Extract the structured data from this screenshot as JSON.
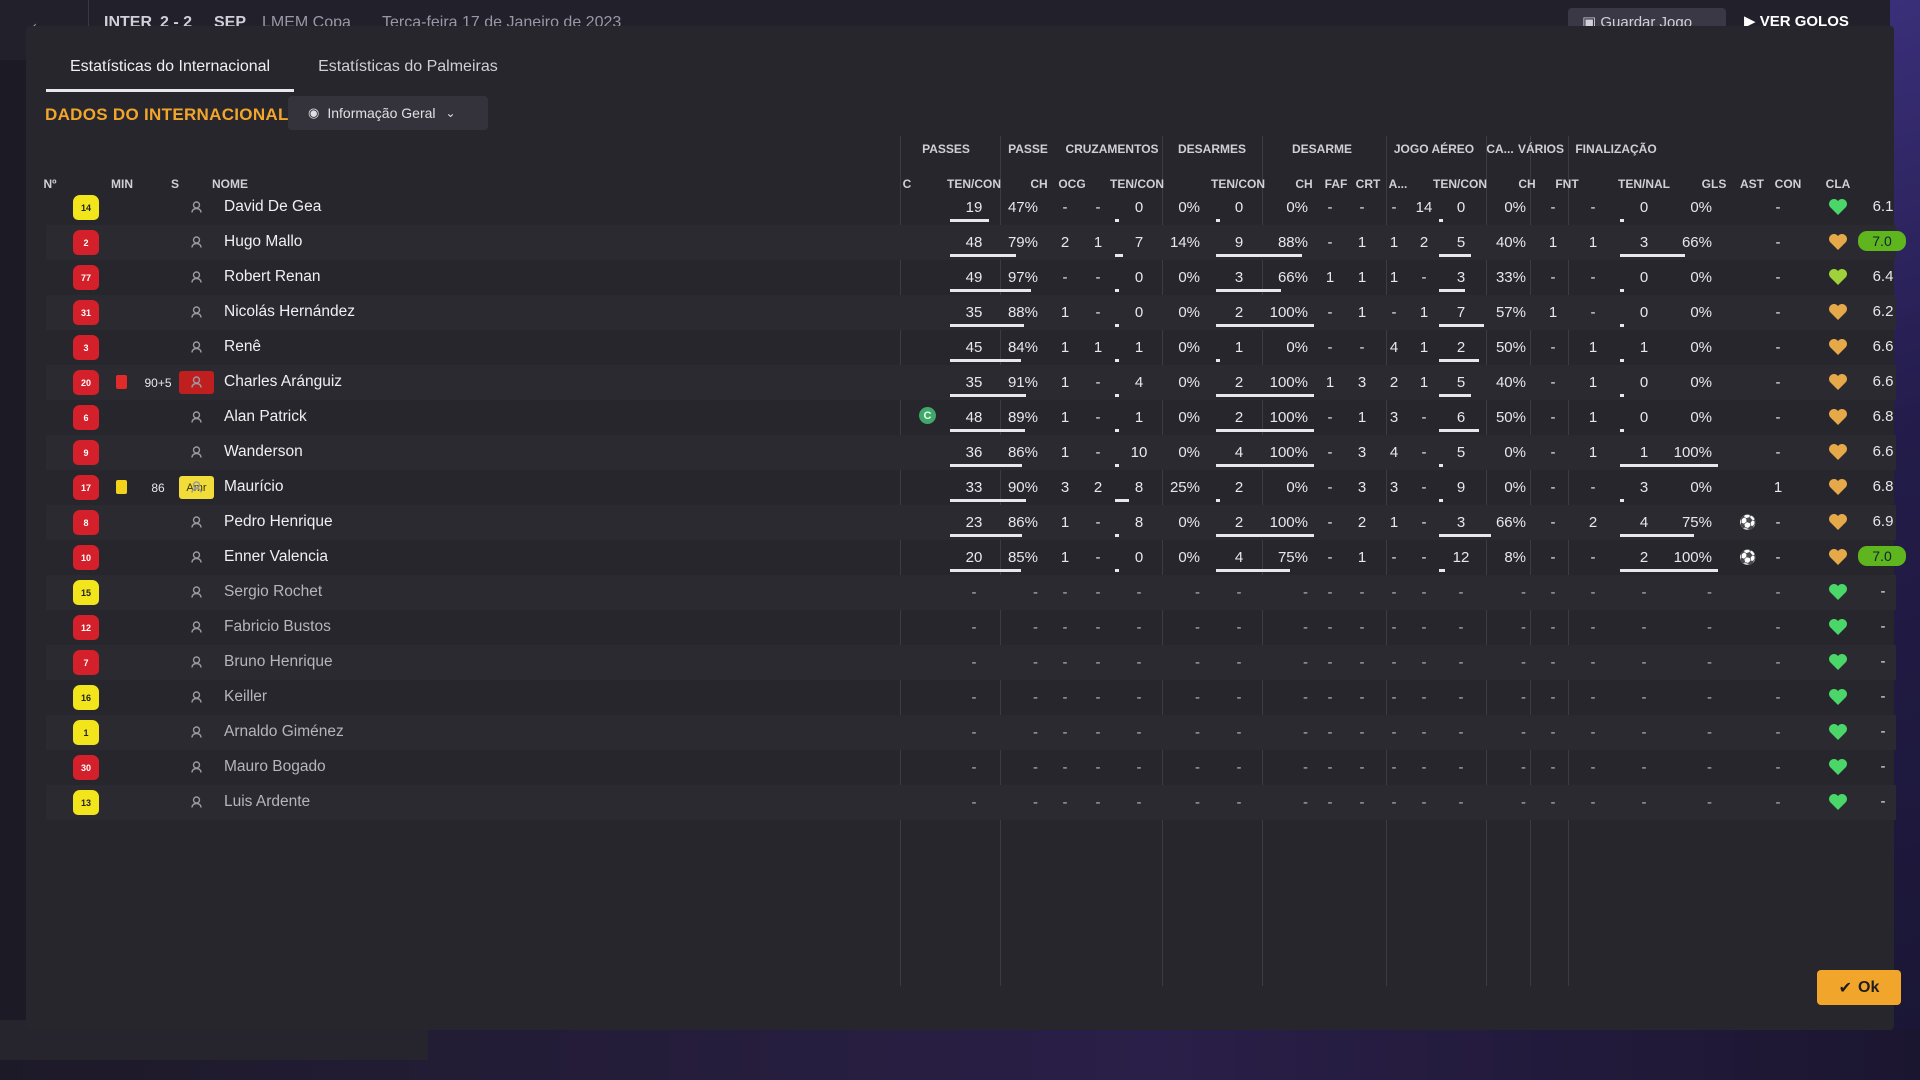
{
  "background": {
    "match_home": "INTER",
    "score": "2 - 2",
    "match_away": "SEP",
    "competition": "LMEM Copa",
    "date": "Terça-feira 17 de Janeiro de 2023",
    "save_label": "Guardar Jogo",
    "play_label": "VER GOLOS"
  },
  "tabs": [
    "Estatísticas do Internacional",
    "Estatísticas do Palmeiras"
  ],
  "section_title": "DADOS DO INTERNACIONAL",
  "view_dropdown": "Informação Geral",
  "group_headers": [
    "PASSES",
    "PASSE",
    "CRUZAMENTOS",
    "DESARMES",
    "DESARME",
    "JOGO AÉREO",
    "CA...",
    "VÁRIOS",
    "FINALIZAÇÃO"
  ],
  "columns": {
    "num": "Nº",
    "min": "MIN",
    "s": "S",
    "name": "NOME",
    "c": "C",
    "passes": "TEN/CON",
    "ch": "CH",
    "ocg": "OCG",
    "cross": "TEN/CON",
    "tackles": "TEN/CON",
    "d_ch": "CH",
    "d_faf": "FAF",
    "d_crt": "CRT",
    "d_a": "A...",
    "aerial": "TEN/CON",
    "ca_ch": "CH",
    "fnt": "FNT",
    "shots": "TEN/NAL",
    "gls": "GLS",
    "ast": "AST",
    "con": "CON",
    "cla": "CLA"
  },
  "colors": {
    "accent": "#f2a52b",
    "home_shirt": "#d4202a",
    "gk_shirt": "#f2e51b",
    "heart_green": "#4bd66a",
    "heart_gold": "#e6b84a"
  },
  "players": [
    {
      "num": "14",
      "shirt": "yellow",
      "name": "David De Gea",
      "pt": "19",
      "pp": "47%",
      "pch": "-",
      "ocg": "-",
      "ct": "0",
      "cp": "0%",
      "dt": "0",
      "dp": "0%",
      "dch": "-",
      "faf": "-",
      "crt": "-",
      "da": "14",
      "at": "0",
      "ap": "0%",
      "cach": "-",
      "fnt": "-",
      "st": "0",
      "sp": "0%",
      "gls": "",
      "ast": "-",
      "con": "green",
      "cla": "6.1"
    },
    {
      "num": "2",
      "shirt": "red",
      "name": "Hugo Mallo",
      "pt": "48",
      "pp": "79%",
      "pch": "2",
      "ocg": "1",
      "ct": "7",
      "cp": "14%",
      "dt": "9",
      "dp": "88%",
      "dch": "-",
      "faf": "1",
      "crt": "1",
      "da": "2",
      "at": "5",
      "ap": "40%",
      "cach": "1",
      "fnt": "1",
      "st": "3",
      "sp": "66%",
      "gls": "",
      "ast": "-",
      "con": "gold",
      "cla": "7.0",
      "hi": true
    },
    {
      "num": "77",
      "shirt": "red",
      "name": "Robert Renan",
      "pt": "49",
      "pp": "97%",
      "pch": "-",
      "ocg": "-",
      "ct": "0",
      "cp": "0%",
      "dt": "3",
      "dp": "66%",
      "dch": "1",
      "faf": "1",
      "crt": "1",
      "da": "-",
      "at": "3",
      "ap": "33%",
      "cach": "-",
      "fnt": "-",
      "st": "0",
      "sp": "0%",
      "gls": "",
      "ast": "-",
      "con": "lime",
      "cla": "6.4"
    },
    {
      "num": "31",
      "shirt": "red",
      "name": "Nicolás Hernández",
      "pt": "35",
      "pp": "88%",
      "pch": "1",
      "ocg": "-",
      "ct": "0",
      "cp": "0%",
      "dt": "2",
      "dp": "100%",
      "dch": "-",
      "faf": "1",
      "crt": "-",
      "da": "1",
      "at": "7",
      "ap": "57%",
      "cach": "1",
      "fnt": "-",
      "st": "0",
      "sp": "0%",
      "gls": "",
      "ast": "-",
      "con": "gold",
      "cla": "6.2"
    },
    {
      "num": "3",
      "shirt": "red",
      "name": "Renê",
      "pt": "45",
      "pp": "84%",
      "pch": "1",
      "ocg": "1",
      "ct": "1",
      "cp": "0%",
      "dt": "1",
      "dp": "0%",
      "dch": "-",
      "faf": "-",
      "crt": "4",
      "da": "1",
      "at": "2",
      "ap": "50%",
      "cach": "-",
      "fnt": "1",
      "st": "1",
      "sp": "0%",
      "gls": "",
      "ast": "-",
      "con": "gold",
      "cla": "6.6"
    },
    {
      "num": "20",
      "shirt": "red",
      "card": "red",
      "min": "90+5",
      "badge": "",
      "badge_color": "red",
      "name": "Charles Aránguiz",
      "pt": "35",
      "pp": "91%",
      "pch": "1",
      "ocg": "-",
      "ct": "4",
      "cp": "0%",
      "dt": "2",
      "dp": "100%",
      "dch": "1",
      "faf": "3",
      "crt": "2",
      "da": "1",
      "at": "5",
      "ap": "40%",
      "cach": "-",
      "fnt": "1",
      "st": "0",
      "sp": "0%",
      "gls": "",
      "ast": "-",
      "con": "gold",
      "cla": "6.6"
    },
    {
      "num": "6",
      "shirt": "red",
      "name": "Alan Patrick",
      "captain": "C",
      "pt": "48",
      "pp": "89%",
      "pch": "1",
      "ocg": "-",
      "ct": "1",
      "cp": "0%",
      "dt": "2",
      "dp": "100%",
      "dch": "-",
      "faf": "1",
      "crt": "3",
      "da": "-",
      "at": "6",
      "ap": "50%",
      "cach": "-",
      "fnt": "1",
      "st": "0",
      "sp": "0%",
      "gls": "",
      "ast": "-",
      "con": "gold",
      "cla": "6.8"
    },
    {
      "num": "9",
      "shirt": "red",
      "name": "Wanderson",
      "pt": "36",
      "pp": "86%",
      "pch": "1",
      "ocg": "-",
      "ct": "10",
      "cp": "0%",
      "dt": "4",
      "dp": "100%",
      "dch": "-",
      "faf": "3",
      "crt": "4",
      "da": "-",
      "at": "5",
      "ap": "0%",
      "cach": "-",
      "fnt": "1",
      "st": "1",
      "sp": "100%",
      "gls": "",
      "ast": "-",
      "con": "gold",
      "cla": "6.6"
    },
    {
      "num": "17",
      "shirt": "red",
      "card": "yellow",
      "min": "86",
      "badge": "Amr",
      "badge_color": "yellow",
      "name": "Maurício",
      "pt": "33",
      "pp": "90%",
      "pch": "3",
      "ocg": "2",
      "ct": "8",
      "cp": "25%",
      "dt": "2",
      "dp": "0%",
      "dch": "-",
      "faf": "3",
      "crt": "3",
      "da": "-",
      "at": "9",
      "ap": "0%",
      "cach": "-",
      "fnt": "-",
      "st": "3",
      "sp": "0%",
      "gls": "",
      "ast": "1",
      "con": "gold",
      "cla": "6.8"
    },
    {
      "num": "8",
      "shirt": "red",
      "name": "Pedro Henrique",
      "pt": "23",
      "pp": "86%",
      "pch": "1",
      "ocg": "-",
      "ct": "8",
      "cp": "0%",
      "dt": "2",
      "dp": "100%",
      "dch": "-",
      "faf": "2",
      "crt": "1",
      "da": "-",
      "at": "3",
      "ap": "66%",
      "cach": "-",
      "fnt": "2",
      "st": "4",
      "sp": "75%",
      "gls": "ball",
      "ast": "-",
      "con": "gold",
      "cla": "6.9"
    },
    {
      "num": "10",
      "shirt": "red",
      "name": "Enner Valencia",
      "pt": "20",
      "pp": "85%",
      "pch": "1",
      "ocg": "-",
      "ct": "0",
      "cp": "0%",
      "dt": "4",
      "dp": "75%",
      "dch": "-",
      "faf": "1",
      "crt": "-",
      "da": "-",
      "at": "12",
      "ap": "8%",
      "cach": "-",
      "fnt": "-",
      "st": "2",
      "sp": "100%",
      "gls": "ball",
      "ast": "-",
      "con": "gold",
      "cla": "7.0",
      "hi": true
    },
    {
      "num": "15",
      "shirt": "yellow",
      "sub": true,
      "name": "Sergio Rochet"
    },
    {
      "num": "12",
      "shirt": "red",
      "sub": true,
      "name": "Fabricio Bustos"
    },
    {
      "num": "7",
      "shirt": "red",
      "sub": true,
      "name": "Bruno Henrique"
    },
    {
      "num": "16",
      "shirt": "yellow",
      "sub": true,
      "name": "Keiller"
    },
    {
      "num": "1",
      "shirt": "yellow",
      "sub": true,
      "name": "Arnaldo Giménez"
    },
    {
      "num": "30",
      "shirt": "red",
      "sub": true,
      "name": "Mauro Bogado"
    },
    {
      "num": "13",
      "shirt": "yellow",
      "sub": true,
      "name": "Luis Ardente"
    }
  ],
  "ok_label": "Ok"
}
